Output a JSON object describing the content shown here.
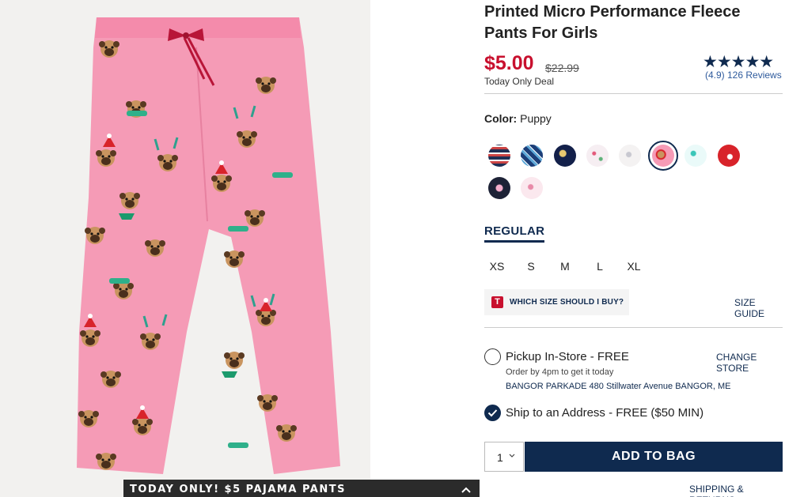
{
  "product": {
    "title": "Printed Micro Performance Fleece Pants For Girls",
    "price": "$5.00",
    "original_price": "$22.99",
    "deal_label": "Today Only Deal",
    "rating_stars": "★★★★★",
    "rating_text": "(4.9) 126 Reviews"
  },
  "color": {
    "label": "Color:",
    "selected": "Puppy"
  },
  "size_tab": "REGULAR",
  "sizes": [
    "XS",
    "S",
    "M",
    "L",
    "XL"
  ],
  "fit": {
    "logo": "T",
    "prompt": "WHICH SIZE SHOULD I BUY?",
    "size_guide": "SIZE GUIDE"
  },
  "fulfillment": {
    "pickup_label": "Pickup In-Store - FREE",
    "change_store": "CHANGE STORE",
    "order_by": "Order by 4pm to get it today",
    "store_address": "BANGOR PARKADE 480 Stillwater Avenue  BANGOR, ME",
    "ship_label": "Ship to an Address - FREE ($50 MIN)"
  },
  "purchase": {
    "quantity": "1",
    "add_to_bag": "ADD TO BAG",
    "shipping_returns": "SHIPPING & RETURNS"
  },
  "promo_banner": "TODAY ONLY! $5 PAJAMA PANTS",
  "colors": {
    "accent": "#0f2a4f",
    "sale": "#c8102e",
    "pants_pink": "#f59bb6"
  }
}
